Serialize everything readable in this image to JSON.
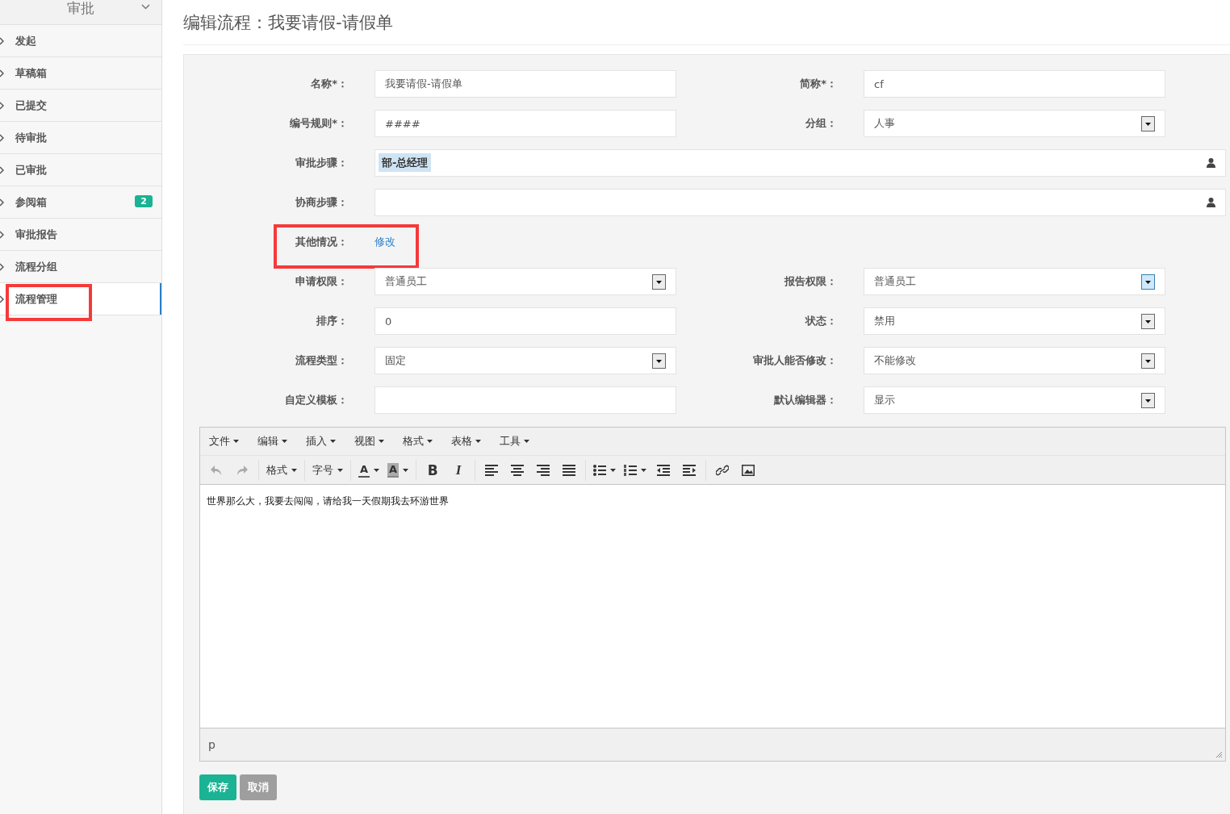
{
  "sidebar": {
    "title": "审批",
    "items": [
      {
        "label": "发起",
        "selected": false,
        "annotated": false
      },
      {
        "label": "草稿箱",
        "selected": false,
        "annotated": false
      },
      {
        "label": "已提交",
        "selected": false,
        "annotated": false
      },
      {
        "label": "待审批",
        "selected": false,
        "annotated": false
      },
      {
        "label": "已审批",
        "selected": false,
        "annotated": false
      },
      {
        "label": "参阅箱",
        "selected": false,
        "annotated": false,
        "badge": "2"
      },
      {
        "label": "审批报告",
        "selected": false,
        "annotated": false
      },
      {
        "label": "流程分组",
        "selected": false,
        "annotated": false
      },
      {
        "label": "流程管理",
        "selected": true,
        "annotated": true
      }
    ]
  },
  "page_title": "编辑流程：我要请假-请假单",
  "form": {
    "rows": [
      {
        "fields": [
          {
            "kind": "text",
            "label": "名称*：",
            "value": "我要请假-请假单"
          },
          {
            "kind": "text",
            "label": "简称*：",
            "value": "cf"
          }
        ]
      },
      {
        "fields": [
          {
            "kind": "text",
            "label": "编号规则*：",
            "value": "####"
          },
          {
            "kind": "select",
            "label": "分组：",
            "value": "人事",
            "focused": false
          }
        ]
      },
      {
        "fields": [
          {
            "kind": "picker",
            "label": "审批步骤：",
            "tokens": [
              "部-总经理"
            ]
          }
        ]
      },
      {
        "fields": [
          {
            "kind": "picker",
            "label": "协商步骤："
          }
        ]
      },
      {
        "fields": [
          {
            "kind": "link",
            "label": "其他情况：",
            "link": "修改",
            "annotated": true
          }
        ]
      },
      {
        "fields": [
          {
            "kind": "select",
            "label": "申请权限：",
            "value": "普通员工",
            "focused": false
          },
          {
            "kind": "select",
            "label": "报告权限：",
            "value": "普通员工",
            "focused": true
          }
        ]
      },
      {
        "fields": [
          {
            "kind": "text",
            "label": "排序：",
            "value": "0"
          },
          {
            "kind": "select",
            "label": "状态：",
            "value": "禁用",
            "focused": false
          }
        ]
      },
      {
        "fields": [
          {
            "kind": "select",
            "label": "流程类型：",
            "value": "固定",
            "focused": false
          },
          {
            "kind": "select",
            "label": "审批人能否修改：",
            "value": "不能修改",
            "focused": false
          }
        ]
      },
      {
        "fields": [
          {
            "kind": "text",
            "label": "自定义模板："
          },
          {
            "kind": "select",
            "label": "默认编辑器：",
            "value": "显示",
            "focused": false
          }
        ]
      }
    ]
  },
  "editor": {
    "menus": [
      "文件",
      "编辑",
      "插入",
      "视图",
      "格式",
      "表格",
      "工具"
    ],
    "history": [
      {
        "disabled": true
      },
      {
        "disabled": true
      }
    ],
    "format_label": "格式",
    "size_label": "字号",
    "font_color": "A",
    "back_color": "A",
    "bold": "B",
    "italic": "I",
    "content": "世界那么大，我要去闯闯，请给我一天假期我去环游世界",
    "path": "p"
  },
  "buttons": [
    {
      "label": "保存",
      "disabled": false
    },
    {
      "label": "取消",
      "disabled": true
    }
  ]
}
